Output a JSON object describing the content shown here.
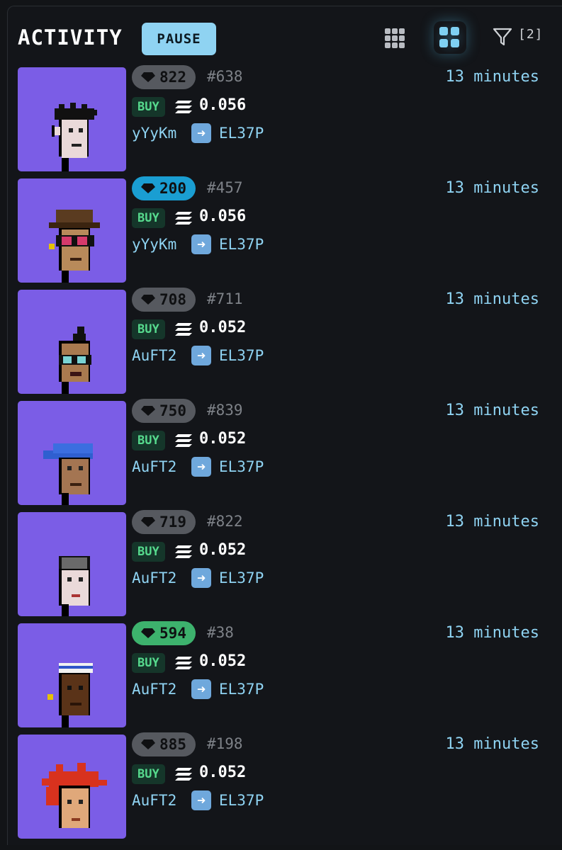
{
  "header": {
    "title": "ACTIVITY",
    "pause_label": "PAUSE",
    "filter_count": "[2]",
    "icons": [
      "grid-small-icon",
      "grid-large-icon",
      "filter-icon"
    ],
    "accent_color": "#8fd3f2"
  },
  "activity": [
    {
      "rank": "822",
      "rank_color": "gray",
      "token": "#638",
      "time": "13 minutes",
      "type": "BUY",
      "price": "0.056",
      "from": "yYyKm",
      "to": "EL37P",
      "avatar": "punk-white-spiky-hair"
    },
    {
      "rank": "200",
      "rank_color": "blue",
      "token": "#457",
      "time": "13 minutes",
      "type": "BUY",
      "price": "0.056",
      "from": "yYyKm",
      "to": "EL37P",
      "avatar": "punk-brown-hat-shades"
    },
    {
      "rank": "708",
      "rank_color": "gray",
      "token": "#711",
      "time": "13 minutes",
      "type": "BUY",
      "price": "0.052",
      "from": "AuFT2",
      "to": "EL37P",
      "avatar": "punk-mohawk-glasses"
    },
    {
      "rank": "750",
      "rank_color": "gray",
      "token": "#839",
      "time": "13 minutes",
      "type": "BUY",
      "price": "0.052",
      "from": "AuFT2",
      "to": "EL37P",
      "avatar": "punk-blue-cap"
    },
    {
      "rank": "719",
      "rank_color": "gray",
      "token": "#822",
      "time": "13 minutes",
      "type": "BUY",
      "price": "0.052",
      "from": "AuFT2",
      "to": "EL37P",
      "avatar": "punk-gray-cap"
    },
    {
      "rank": "594",
      "rank_color": "green",
      "token": "#38",
      "time": "13 minutes",
      "type": "BUY",
      "price": "0.052",
      "from": "AuFT2",
      "to": "EL37P",
      "avatar": "punk-dark-headband"
    },
    {
      "rank": "885",
      "rank_color": "gray",
      "token": "#198",
      "time": "13 minutes",
      "type": "BUY",
      "price": "0.052",
      "from": "AuFT2",
      "to": "EL37P",
      "avatar": "punk-red-hair"
    }
  ]
}
